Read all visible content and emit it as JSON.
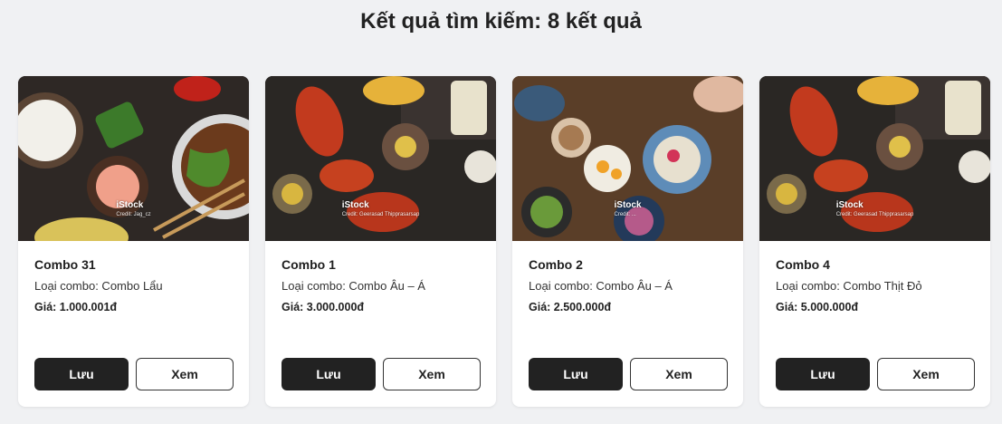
{
  "page": {
    "title": "Kết quả tìm kiếm: 8 kết quả"
  },
  "colors": {
    "page_bg": "#f0f1f3",
    "card_bg": "#ffffff",
    "primary_button": "#222222"
  },
  "results": [
    {
      "name": "Combo 31",
      "type_label": "Loại combo: Combo Lẩu",
      "price_label": "Giá: 1.000.001đ",
      "watermark": "iStock",
      "watermark_credit": "Credit: Jag_cz",
      "save_label": "Lưu",
      "view_label": "Xem"
    },
    {
      "name": "Combo 1",
      "type_label": "Loại combo: Combo Âu – Á",
      "price_label": "Giá: 3.000.000đ",
      "watermark": "iStock",
      "watermark_credit": "Credit: Geerasad Thipprasarsap",
      "save_label": "Lưu",
      "view_label": "Xem"
    },
    {
      "name": "Combo 2",
      "type_label": "Loại combo: Combo Âu – Á",
      "price_label": "Giá: 2.500.000đ",
      "watermark": "iStock",
      "watermark_credit": "Credit: ...",
      "save_label": "Lưu",
      "view_label": "Xem"
    },
    {
      "name": "Combo 4",
      "type_label": "Loại combo: Combo Thịt Đỏ",
      "price_label": "Giá: 5.000.000đ",
      "watermark": "iStock",
      "watermark_credit": "Credit: Geerasad Thipprasarsap",
      "save_label": "Lưu",
      "view_label": "Xem"
    }
  ]
}
